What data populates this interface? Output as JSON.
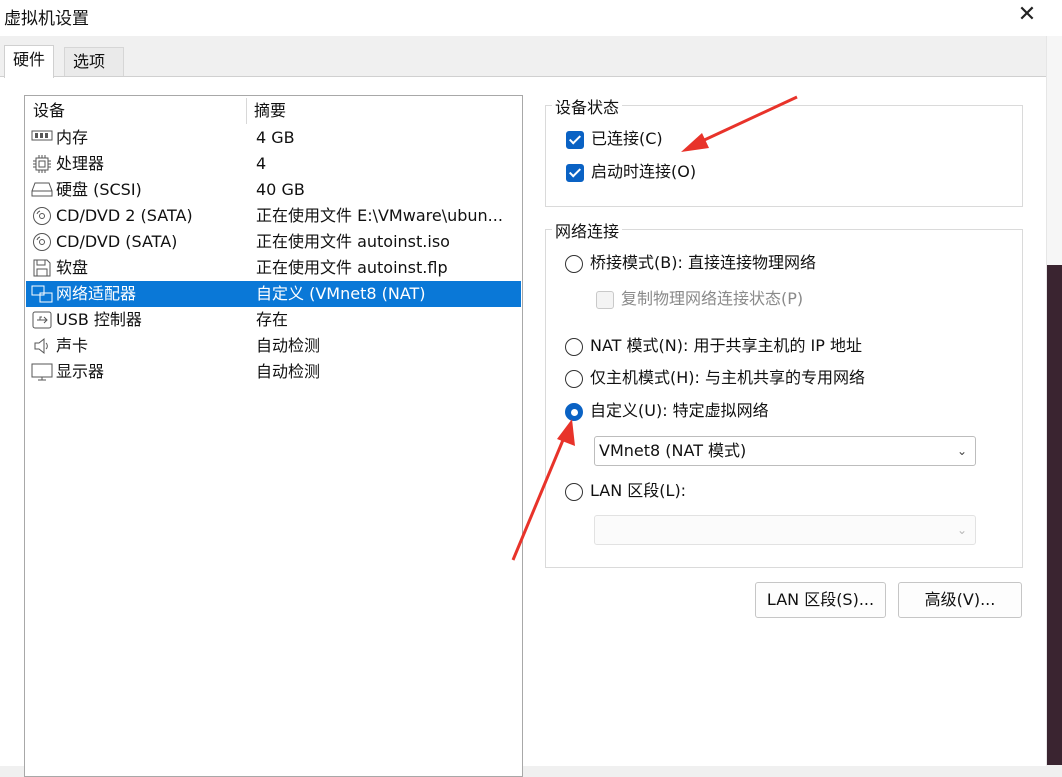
{
  "window": {
    "title": "虚拟机设置",
    "close_glyph": "✕"
  },
  "tabs": [
    {
      "label": "硬件"
    },
    {
      "label": "选项"
    }
  ],
  "device_list": {
    "col_device": "设备",
    "col_summary": "摘要",
    "rows": [
      {
        "icon": "memory-icon",
        "name": "内存",
        "summary": "4 GB"
      },
      {
        "icon": "processor-icon",
        "name": "处理器",
        "summary": "4"
      },
      {
        "icon": "hard-disk-icon",
        "name": "硬盘 (SCSI)",
        "summary": "40 GB"
      },
      {
        "icon": "cd-dvd-icon",
        "name": "CD/DVD 2 (SATA)",
        "summary": "正在使用文件 E:\\VMware\\ubun..."
      },
      {
        "icon": "cd-dvd-icon",
        "name": "CD/DVD (SATA)",
        "summary": "正在使用文件 autoinst.iso"
      },
      {
        "icon": "floppy-icon",
        "name": "软盘",
        "summary": "正在使用文件 autoinst.flp"
      },
      {
        "icon": "network-adapter-icon",
        "name": "网络适配器",
        "summary": "自定义 (VMnet8 (NAT)"
      },
      {
        "icon": "usb-icon",
        "name": "USB 控制器",
        "summary": "存在"
      },
      {
        "icon": "speaker-icon",
        "name": "声卡",
        "summary": "自动检测"
      },
      {
        "icon": "monitor-icon",
        "name": "显示器",
        "summary": "自动检测"
      }
    ],
    "selected_index": 6
  },
  "device_status": {
    "title": "设备状态",
    "connected": {
      "label": "已连接(C)",
      "checked": true
    },
    "connect_at_power_on": {
      "label": "启动时连接(O)",
      "checked": true
    }
  },
  "network_connection": {
    "title": "网络连接",
    "bridged": {
      "label": "桥接模式(B): 直接连接物理网络",
      "selected": false
    },
    "replicate": {
      "label": "复制物理网络连接状态(P)",
      "checked": false,
      "enabled": false
    },
    "nat": {
      "label": "NAT 模式(N): 用于共享主机的 IP 地址",
      "selected": false
    },
    "host_only": {
      "label": "仅主机模式(H): 与主机共享的专用网络",
      "selected": false
    },
    "custom": {
      "label": "自定义(U): 特定虚拟网络",
      "selected": true,
      "value": "VMnet8 (NAT 模式)"
    },
    "lan_segment": {
      "label": "LAN 区段(L):",
      "selected": false,
      "value": ""
    }
  },
  "buttons": {
    "lan_segments": "LAN 区段(S)...",
    "advanced": "高级(V)..."
  },
  "colors": {
    "selection": "#0a78d7",
    "checkbox": "#0a62c4",
    "annotation_arrow": "#e8332a"
  }
}
